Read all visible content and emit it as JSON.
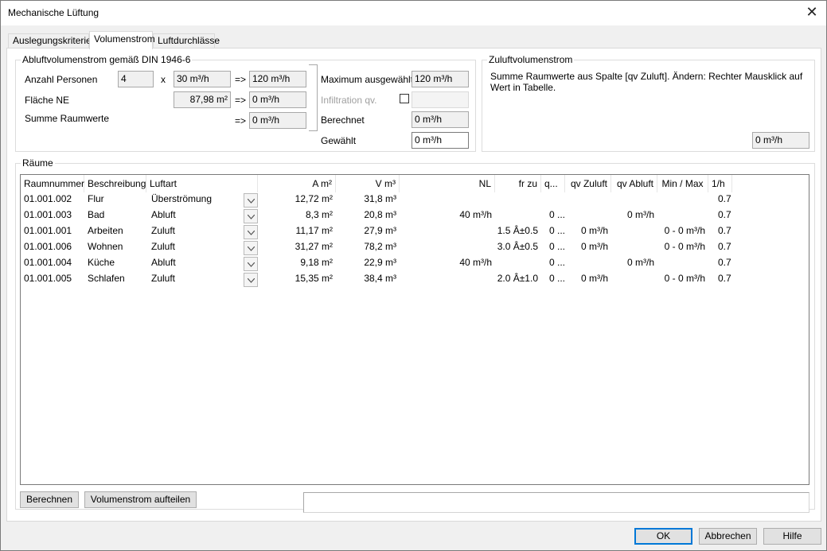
{
  "window": {
    "title": "Mechanische Lüftung"
  },
  "tabs": [
    {
      "label": "Auslegungskriterien",
      "active": false
    },
    {
      "label": "Volumenstrom",
      "active": true
    },
    {
      "label": "Luftdurchlässe",
      "active": false
    }
  ],
  "abluft": {
    "legend": "Abluftvolumenstrom gemäß DIN 1946-6",
    "anzahl_personen_label": "Anzahl Personen",
    "anzahl_personen_value": "4",
    "times": "x",
    "per_person": "30 m³/h",
    "arrow": "=>",
    "personen_result": "120 m³/h",
    "flaeche_label": "Fläche NE",
    "flaeche_value": "87,98 m²",
    "flaeche_result": "0 m³/h",
    "summe_label": "Summe Raumwerte",
    "summe_result": "0 m³/h",
    "maximum_label": "Maximum ausgewählt",
    "maximum_value": "120 m³/h",
    "infiltration_label": "Infiltration qv.",
    "infiltration_checked": false,
    "infiltration_value": "",
    "berechnet_label": "Berechnet",
    "berechnet_value": "0 m³/h",
    "gewaehlt_label": "Gewählt",
    "gewaehlt_value": "0 m³/h"
  },
  "zuluft": {
    "legend": "Zuluftvolumenstrom",
    "text": "Summe Raumwerte aus Spalte [qv Zuluft]. Ändern: Rechter Mausklick auf Wert in Tabelle.",
    "value": "0 m³/h"
  },
  "raeume": {
    "legend": "Räume",
    "columns": [
      "Raumnummer",
      "Beschreibung",
      "Luftart",
      "A m²",
      "V m³",
      "NL",
      "fr zu",
      "q...",
      "qv Zuluft",
      "qv Abluft",
      "Min / Max",
      "1/h"
    ],
    "rows": [
      {
        "nr": "01.001.002",
        "beschreibung": "Flur",
        "luftart": "Überströmung",
        "a": "12,72 m²",
        "v": "31,8 m³",
        "nl": "",
        "frzu": "",
        "q": "",
        "qvzu": "",
        "qvab": "",
        "minmax": "",
        "h": "0.7"
      },
      {
        "nr": "01.001.003",
        "beschreibung": "Bad",
        "luftart": "Abluft",
        "a": "8,3 m²",
        "v": "20,8 m³",
        "nl": "40 m³/h",
        "frzu": "",
        "q": "0 ...",
        "qvzu": "",
        "qvab": "0 m³/h",
        "minmax": "",
        "h": "0.7"
      },
      {
        "nr": "01.001.001",
        "beschreibung": "Arbeiten",
        "luftart": "Zuluft",
        "a": "11,17 m²",
        "v": "27,9 m³",
        "nl": "",
        "frzu": "1.5 Â±0.5",
        "q": "0 ...",
        "qvzu": "0 m³/h",
        "qvab": "",
        "minmax": "0 - 0 m³/h",
        "h": "0.7"
      },
      {
        "nr": "01.001.006",
        "beschreibung": "Wohnen",
        "luftart": "Zuluft",
        "a": "31,27 m²",
        "v": "78,2 m³",
        "nl": "",
        "frzu": "3.0 Â±0.5",
        "q": "0 ...",
        "qvzu": "0 m³/h",
        "qvab": "",
        "minmax": "0 - 0 m³/h",
        "h": "0.7"
      },
      {
        "nr": "01.001.004",
        "beschreibung": "Küche",
        "luftart": "Abluft",
        "a": "9,18 m²",
        "v": "22,9 m³",
        "nl": "40 m³/h",
        "frzu": "",
        "q": "0 ...",
        "qvzu": "",
        "qvab": "0 m³/h",
        "minmax": "",
        "h": "0.7"
      },
      {
        "nr": "01.001.005",
        "beschreibung": "Schlafen",
        "luftart": "Zuluft",
        "a": "15,35 m²",
        "v": "38,4 m³",
        "nl": "",
        "frzu": "2.0 Â±1.0",
        "q": "0 ...",
        "qvzu": "0 m³/h",
        "qvab": "",
        "minmax": "0 - 0 m³/h",
        "h": "0.7"
      }
    ]
  },
  "actions": {
    "berechnen": "Berechnen",
    "aufteilen": "Volumenstrom aufteilen",
    "status": ""
  },
  "footer": {
    "ok": "OK",
    "abbrechen": "Abbrechen",
    "hilfe": "Hilfe"
  }
}
